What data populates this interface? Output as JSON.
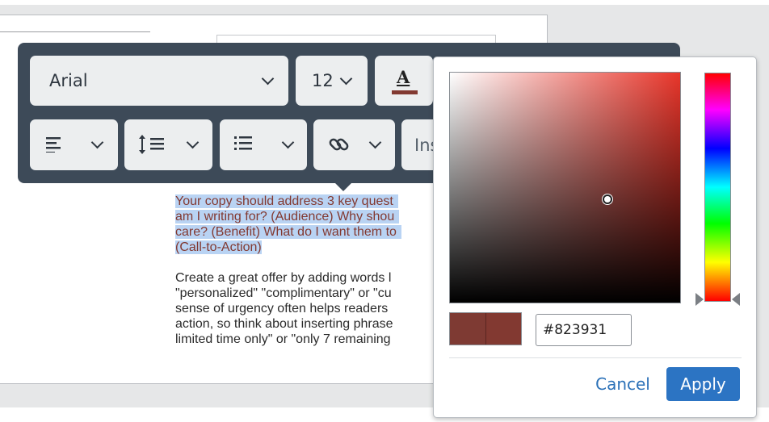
{
  "toolbar": {
    "font_family": "Arial",
    "font_size": "12",
    "font_color_letter": "A",
    "insert_label": "Ins"
  },
  "document": {
    "paragraph1": [
      "Your copy should address 3 key quest",
      "am I writing for? (Audience) Why shou",
      "care? (Benefit) What do I want them to",
      "(Call-to-Action)"
    ],
    "paragraph2": [
      "Create a great offer by adding words l",
      "\"personalized\" \"complimentary\" or \"cu",
      "sense of urgency often helps readers",
      "action, so think about inserting phrase",
      "limited time only\" or \"only 7 remaining"
    ]
  },
  "color_picker": {
    "hex_value": "#823931",
    "current_color": "#823931",
    "previous_color": "#7e3a33",
    "cancel_label": "Cancel",
    "apply_label": "Apply"
  },
  "icons": {
    "font_color": "font-color-icon",
    "align": "align-left-icon",
    "line_height": "line-height-icon",
    "list": "bulleted-list-icon",
    "link": "link-icon",
    "chevron": "chevron-down-icon"
  },
  "colors": {
    "toolbar_bg": "#3d4a58",
    "selection_highlight": "#b9d3f3",
    "selected_text": "#823931",
    "apply_button": "#2c74c3",
    "cancel_text": "#2b71b8"
  }
}
